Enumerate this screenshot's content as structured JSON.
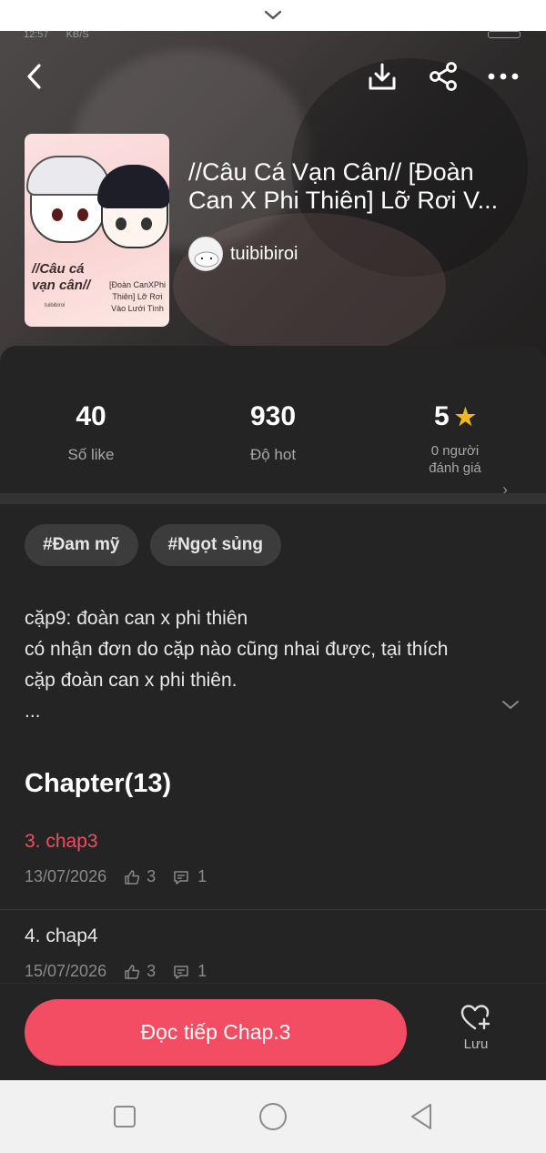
{
  "status_bar": {
    "time": "12:57",
    "net_speed": "KB/S"
  },
  "header": {
    "back_icon": "chevron-left-icon",
    "download_icon": "download-icon",
    "share_icon": "share-icon",
    "more_icon": "more-horizontal-icon"
  },
  "book": {
    "title": "//Câu Cá Vạn Cân// [Đoàn Can X Phi Thiên] Lỡ Rơi V...",
    "author": "tuibibiroi",
    "cover": {
      "title_line1": "//Câu cá",
      "title_line2": "vạn cân//",
      "subtitle": "[Đoàn CanXPhi Thiên] Lỡ Rơi Vào Lưới Tình",
      "author": "tuibibiroi"
    }
  },
  "stats": {
    "likes": {
      "value": "40",
      "label": "Số like"
    },
    "hot": {
      "value": "930",
      "label": "Độ hot"
    },
    "rating": {
      "value": "5",
      "label_line1": "0 người",
      "label_line2": "đánh giá"
    }
  },
  "tags": [
    "#Đam mỹ",
    "#Ngọt sủng"
  ],
  "description": {
    "line1": "cặp9: đoàn can x phi thiên",
    "line2": "có nhận đơn do cặp nào cũng nhai được, tại thích",
    "line3": "cặp đoàn can x phi thiên.",
    "line4": "..."
  },
  "chapters": {
    "heading": "Chapter(13)",
    "items": [
      {
        "title": "3. chap3",
        "date": "13/07/2026",
        "likes": "3",
        "comments": "1",
        "active": true
      },
      {
        "title": "4. chap4",
        "date": "15/07/2026",
        "likes": "3",
        "comments": "1",
        "active": false
      }
    ]
  },
  "actions": {
    "read_label": "Đọc tiếp Chap.3",
    "save_label": "Lưu"
  },
  "colors": {
    "accent": "#f24d63",
    "panel": "#242424",
    "star": "#f5b81a"
  }
}
